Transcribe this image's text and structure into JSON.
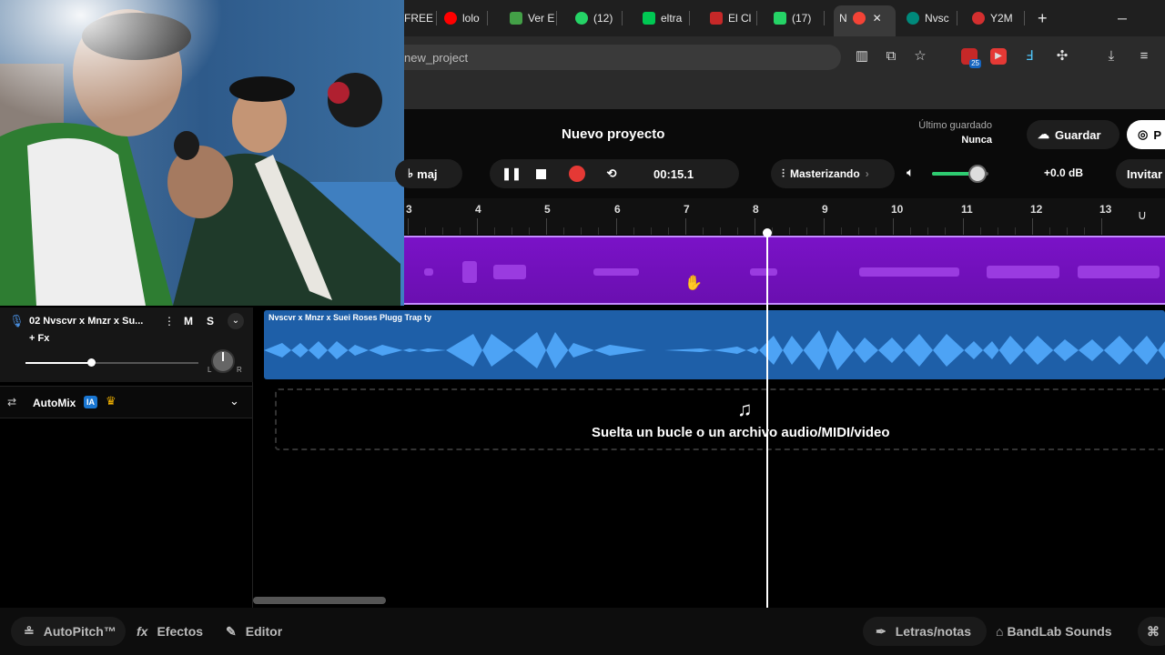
{
  "browser": {
    "tabs": [
      {
        "label": "FREE",
        "color": "#e53935"
      },
      {
        "label": "lolo",
        "color": "#ff0000"
      },
      {
        "label": "Ver E",
        "color": "#43a047"
      },
      {
        "label": "(12)",
        "color": "#25d366"
      },
      {
        "label": "eltra",
        "color": "#00c853"
      },
      {
        "label": "El Cl",
        "color": "#c62828"
      },
      {
        "label": "(17)",
        "color": "#25d366"
      },
      {
        "label": "N",
        "color": "#f44336",
        "active": true
      },
      {
        "label": "Nvsc",
        "color": "#00897b"
      },
      {
        "label": "Y2M",
        "color": "#d32f2f"
      }
    ],
    "new_tab": "+",
    "url": "new_project",
    "extension_badge": "25"
  },
  "header": {
    "project_title": "Nuevo proyecto",
    "last_saved_label": "Último guardado",
    "last_saved_value": "Nunca",
    "save_button": "Guardar",
    "publish_button": "P",
    "key_label": "maj",
    "timecode": "00:15.1",
    "mastering_label": "Masterizando",
    "volume_db": "+0.0 dB",
    "invite_button": "Invitar",
    "volume_level": 0.8
  },
  "ruler": {
    "ticks": [
      "3",
      "4",
      "5",
      "6",
      "7",
      "8",
      "9",
      "10",
      "11",
      "12",
      "13"
    ]
  },
  "track": {
    "name": "02  Nvscvr x Mnzr x Su...",
    "fx_label": "+ Fx",
    "mute": "M",
    "solo": "S",
    "clip_title": "Nvscvr x Mnzr x Suei Roses Plugg Trap ty",
    "volume": 0.38,
    "pan_left": "L",
    "pan_right": "R"
  },
  "automix": {
    "label": "AutoMix",
    "badge": "IA"
  },
  "dropzone": {
    "text": "Suelta un bucle o un archivo audio/MIDI/video"
  },
  "bottom": {
    "autopitch": "AutoPitch™",
    "effects": "Efectos",
    "editor": "Editor",
    "lyrics": "Letras/notas",
    "sounds": "BandLab Sounds"
  },
  "colors": {
    "accent_purple": "#7a12c7",
    "clip_blue": "#1e5fa8",
    "record_red": "#e53935"
  }
}
